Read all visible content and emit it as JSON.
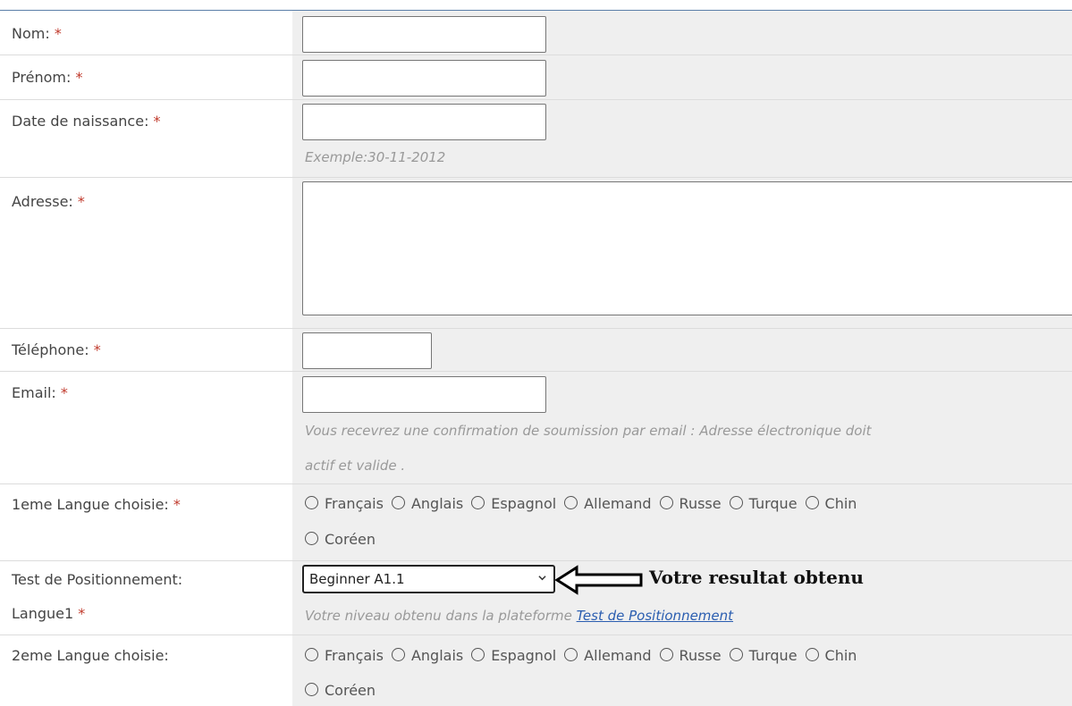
{
  "form": {
    "required_mark": "*",
    "nom": {
      "label": "Nom:",
      "value": ""
    },
    "prenom": {
      "label": "Prénom:",
      "value": ""
    },
    "date_naissance": {
      "label": "Date de naissance:",
      "value": "",
      "hint": "Exemple:30-11-2012"
    },
    "adresse": {
      "label": "Adresse:",
      "value": ""
    },
    "telephone": {
      "label": "Téléphone:",
      "value": ""
    },
    "email": {
      "label": "Email:",
      "value": "",
      "hint_line1": "Vous recevrez une confirmation de soumission par email : Adresse électronique doit",
      "hint_line2": "actif et valide ."
    },
    "langue1": {
      "label": "1eme Langue choisie:",
      "options": [
        "Français",
        "Anglais",
        "Espagnol",
        "Allemand",
        "Russe",
        "Turque",
        "Chin",
        "Coréen"
      ]
    },
    "test_positionnement": {
      "label_line1": "Test de Positionnement:",
      "label_line2": "Langue1",
      "selected": "Beginner A1.1",
      "annotation": "Votre resultat obtenu",
      "hint_prefix": "Votre niveau obtenu dans la plateforme ",
      "hint_link": "Test de Positionnement"
    },
    "langue2": {
      "label": "2eme Langue choisie:",
      "options": [
        "Français",
        "Anglais",
        "Espagnol",
        "Allemand",
        "Russe",
        "Turque",
        "Chin",
        "Coréen"
      ]
    }
  }
}
